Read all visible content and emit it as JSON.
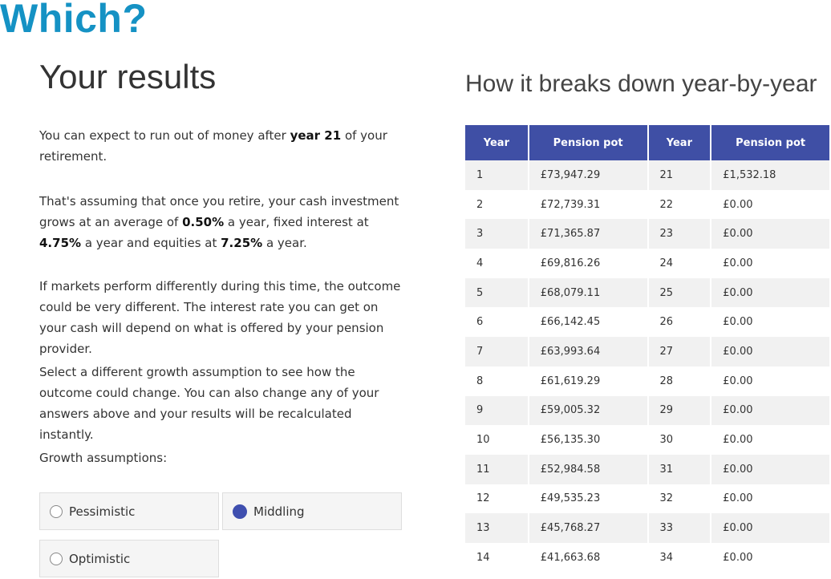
{
  "brand": "Which?",
  "results": {
    "title": "Your results",
    "para1": {
      "pre": "You can expect to run out of money after ",
      "bold": "year 21",
      "post": " of your retirement."
    },
    "para2": {
      "t1": "That's assuming that once you retire, your cash investment grows at an average of ",
      "b1": "0.50%",
      "t2": " a year, fixed interest at ",
      "b2": "4.75%",
      "t3": " a year and equities at ",
      "b3": "7.25%",
      "t4": " a year."
    },
    "para3": "If markets perform differently during this time, the outcome could be very different. The interest rate you can get on your cash will depend on what is offered by your pension provider.",
    "para4": "Select a different growth assumption to see how the outcome could change. You can also change any of your answers above and your results will be recalculated instantly.",
    "growth_label": "Growth assumptions:",
    "options": [
      {
        "label": "Pessimistic",
        "selected": false
      },
      {
        "label": "Middling",
        "selected": true
      },
      {
        "label": "Optimistic",
        "selected": false
      }
    ]
  },
  "breakdown": {
    "title": "How it breaks down year-by-year",
    "headers": [
      "Year",
      "Pension pot",
      "Year",
      "Pension pot"
    ],
    "rows": [
      [
        "1",
        "£73,947.29",
        "21",
        "£1,532.18"
      ],
      [
        "2",
        "£72,739.31",
        "22",
        "£0.00"
      ],
      [
        "3",
        "£71,365.87",
        "23",
        "£0.00"
      ],
      [
        "4",
        "£69,816.26",
        "24",
        "£0.00"
      ],
      [
        "5",
        "£68,079.11",
        "25",
        "£0.00"
      ],
      [
        "6",
        "£66,142.45",
        "26",
        "£0.00"
      ],
      [
        "7",
        "£63,993.64",
        "27",
        "£0.00"
      ],
      [
        "8",
        "£61,619.29",
        "28",
        "£0.00"
      ],
      [
        "9",
        "£59,005.32",
        "29",
        "£0.00"
      ],
      [
        "10",
        "£56,135.30",
        "30",
        "£0.00"
      ],
      [
        "11",
        "£52,984.58",
        "31",
        "£0.00"
      ],
      [
        "12",
        "£49,535.23",
        "32",
        "£0.00"
      ],
      [
        "13",
        "£45,768.27",
        "33",
        "£0.00"
      ],
      [
        "14",
        "£41,663.68",
        "34",
        "£0.00"
      ]
    ]
  },
  "colors": {
    "brand": "#1592c4",
    "header": "#3f4fa5",
    "radio_selected": "#3f4faf"
  }
}
